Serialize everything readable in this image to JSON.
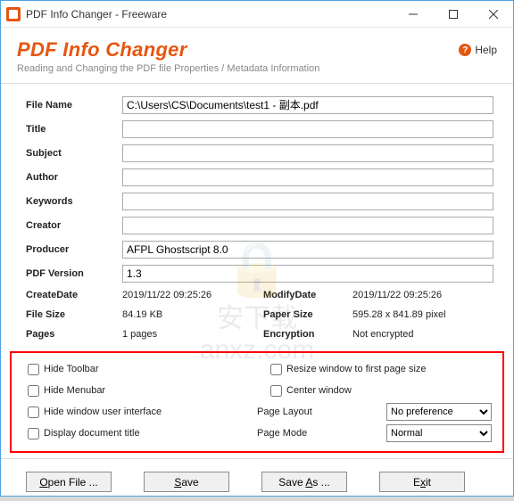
{
  "titlebar": {
    "title": "PDF Info Changer - Freeware"
  },
  "header": {
    "title": "PDF Info Changer",
    "subtitle": "Reading and Changing the PDF file Properties / Metadata Information",
    "help": "Help"
  },
  "labels": {
    "file_name": "File Name",
    "title": "Title",
    "subject": "Subject",
    "author": "Author",
    "keywords": "Keywords",
    "creator": "Creator",
    "producer": "Producer",
    "pdf_version": "PDF Version",
    "create_date": "CreateDate",
    "modify_date": "ModifyDate",
    "file_size": "File Size",
    "paper_size": "Paper Size",
    "pages": "Pages",
    "encryption": "Encryption"
  },
  "values": {
    "file_name": "C:\\Users\\CS\\Documents\\test1 - 副本.pdf",
    "title": "",
    "subject": "",
    "author": "",
    "keywords": "",
    "creator": "",
    "producer": "AFPL Ghostscript 8.0",
    "pdf_version": "1.3",
    "create_date": "2019/11/22 09:25:26",
    "modify_date": "2019/11/22 09:25:26",
    "file_size": "84.19 KB",
    "paper_size": "595.28 x 841.89 pixel",
    "pages": "1 pages",
    "encryption": "Not encrypted"
  },
  "options": {
    "hide_toolbar": "Hide Toolbar",
    "hide_menubar": "Hide Menubar",
    "hide_window_ui": "Hide window user interface",
    "display_doc_title": "Display document title",
    "resize_window": "Resize window to first page size",
    "center_window": "Center window",
    "page_layout": "Page Layout",
    "page_mode": "Page Mode",
    "page_layout_value": "No preference",
    "page_mode_value": "Normal"
  },
  "buttons": {
    "open": "Open File ...",
    "open_key": "O",
    "save": "Save",
    "save_key": "S",
    "save_as": "Save As ...",
    "save_as_key": "A",
    "exit": "Exit",
    "exit_key": "x"
  },
  "watermark": {
    "text": "安下载",
    "url": "anxz.com"
  }
}
